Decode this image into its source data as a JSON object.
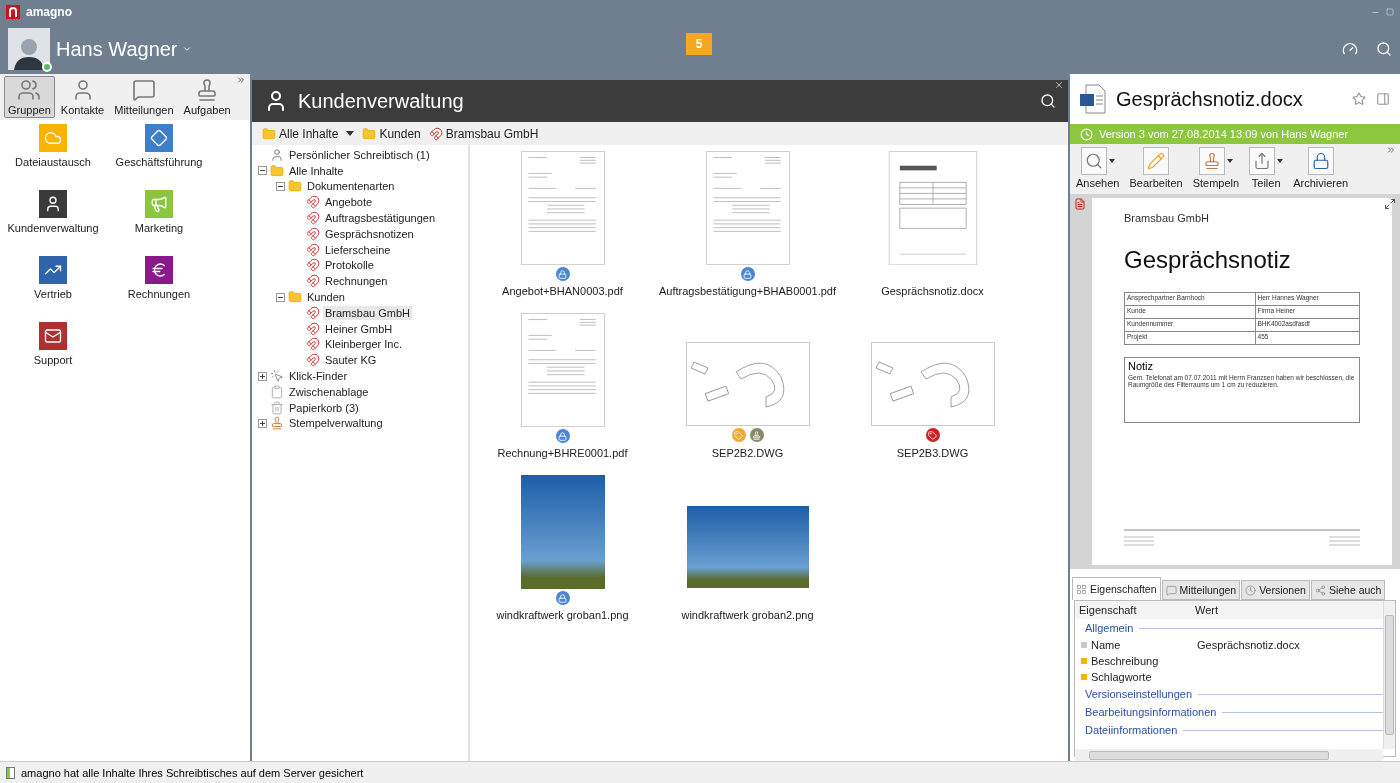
{
  "app": {
    "title": "amagno",
    "user": "Hans Wagner",
    "online": true,
    "notifications": "5"
  },
  "left_tabs": [
    {
      "label": "Gruppen",
      "kind": "group",
      "selected": true
    },
    {
      "label": "Kontakte",
      "kind": "person",
      "selected": false
    },
    {
      "label": "Mitteilungen",
      "kind": "message",
      "selected": false
    },
    {
      "label": "Aufgaben",
      "kind": "stamp",
      "selected": false
    }
  ],
  "groups": [
    {
      "label": "Dateiaustausch",
      "kind": "cloud",
      "color": "#f7b500"
    },
    {
      "label": "Geschäftsführung",
      "kind": "diamond",
      "color": "#3f7fc9"
    },
    {
      "label": "Kundenverwaltung",
      "kind": "person",
      "color": "#3a3a3a"
    },
    {
      "label": "Marketing",
      "kind": "megaphone",
      "color": "#8cc63f"
    },
    {
      "label": "Vertrieb",
      "kind": "trend",
      "color": "#2f64ad"
    },
    {
      "label": "Rechnungen",
      "kind": "euro",
      "color": "#8a1a8a"
    },
    {
      "label": "Support",
      "kind": "mail",
      "color": "#b03030"
    }
  ],
  "workspace": {
    "title": "Kundenverwaltung",
    "breadcrumb": [
      {
        "label": "Alle Inhalte",
        "kind": "folder",
        "dropdown": true
      },
      {
        "label": "Kunden",
        "kind": "folder",
        "dropdown": false
      },
      {
        "label": "Bramsbau GmbH",
        "kind": "magnet",
        "dropdown": false
      }
    ],
    "tree": [
      {
        "label": "Persönlicher Schreibtisch (1)",
        "kind": "person",
        "selected": false
      },
      {
        "label": "Alle Inhalte",
        "kind": "folder",
        "selected": false,
        "expanded": true,
        "children": [
          {
            "label": "Dokumentenarten",
            "kind": "folder",
            "selected": false,
            "expanded": true,
            "children": [
              {
                "label": "Angebote",
                "kind": "magnet",
                "selected": false
              },
              {
                "label": "Auftragsbestätigungen",
                "kind": "magnet",
                "selected": false
              },
              {
                "label": "Gesprächsnotizen",
                "kind": "magnet",
                "selected": false
              },
              {
                "label": "Lieferscheine",
                "kind": "magnet",
                "selected": false
              },
              {
                "label": "Protokolle",
                "kind": "magnet",
                "selected": false
              },
              {
                "label": "Rechnungen",
                "kind": "magnet",
                "selected": false
              }
            ]
          },
          {
            "label": "Kunden",
            "kind": "folder",
            "selected": false,
            "expanded": true,
            "children": [
              {
                "label": "Bramsbau GmbH",
                "kind": "magnet",
                "selected": true
              },
              {
                "label": "Heiner GmbH",
                "kind": "magnet",
                "selected": false
              },
              {
                "label": "Kleinberger Inc.",
                "kind": "magnet",
                "selected": false
              },
              {
                "label": "Sauter KG",
                "kind": "magnet",
                "selected": false
              }
            ]
          }
        ]
      },
      {
        "label": "Klick-Finder",
        "kind": "finder",
        "selected": false,
        "expanded": false
      },
      {
        "label": "Zwischenablage",
        "kind": "clipboard",
        "selected": false
      },
      {
        "label": "Papierkorb (3)",
        "kind": "trash",
        "selected": false
      },
      {
        "label": "Stempelverwaltung",
        "kind": "stamp",
        "selected": false,
        "expanded": false
      }
    ],
    "files": [
      {
        "name": "Angebot+BHAN0003.pdf",
        "kind": "invoice",
        "badges": [
          {
            "kind": "lock",
            "color": "#4a86d4"
          }
        ]
      },
      {
        "name": "Auftragsbestätigung+BHAB0001.pdf",
        "kind": "invoice",
        "badges": [
          {
            "kind": "lock",
            "color": "#4a86d4"
          }
        ]
      },
      {
        "name": "Gesprächsnotiz.docx",
        "kind": "note"
      },
      {
        "name": "Rechnung+BHRE0001.pdf",
        "kind": "invoice",
        "badges": [
          {
            "kind": "lock",
            "color": "#4a86d4"
          }
        ]
      },
      {
        "name": "SEP2B2.DWG",
        "kind": "drawing",
        "badges": [
          {
            "kind": "tag",
            "color": "#f0a830"
          },
          {
            "kind": "stamp",
            "color": "#8a8a6a"
          }
        ]
      },
      {
        "name": "SEP2B3.DWG",
        "kind": "drawing",
        "badges": [
          {
            "kind": "tag",
            "color": "#cc2222"
          }
        ]
      },
      {
        "name": "windkraftwerk groban1.png",
        "kind": "portrait",
        "badges": [
          {
            "kind": "lock",
            "color": "#4a86d4"
          }
        ]
      },
      {
        "name": "windkraftwerk groban2.png",
        "kind": "landscape"
      }
    ]
  },
  "document": {
    "title": "Gesprächsnotiz.docx",
    "version": "Version 3 vom 27.08.2014 13:09 von Hans Wagner",
    "actions": [
      {
        "label": "Ansehen",
        "kind": "view",
        "dropdown": true
      },
      {
        "label": "Bearbeiten",
        "kind": "edit",
        "dropdown": false
      },
      {
        "label": "Stempeln",
        "kind": "stamp",
        "dropdown": true
      },
      {
        "label": "Teilen",
        "kind": "share",
        "dropdown": true
      },
      {
        "label": "Archivieren",
        "kind": "lock",
        "dropdown": false
      }
    ],
    "preview": {
      "company": "Bramsbau GmbH",
      "heading": "Gesprächsnotiz",
      "table": [
        [
          "Ansprechpartner Barnhoch",
          "Herr Hannes Wagner"
        ],
        [
          "Kunde",
          "Firma Heiner"
        ],
        [
          "Kundennummer",
          "BHK4002asdfasdf"
        ],
        [
          "Projekt",
          "455"
        ]
      ],
      "note_title": "Notiz",
      "note_text": "Gem.  Telefonat am 07.07.2011 mit Herrn Franzsen haben wir beschlossen, die Raumgröße des Filterraums um 1 cm zu reduzieren."
    },
    "tabs": [
      {
        "label": "Eigenschaften",
        "kind": "grid",
        "selected": true
      },
      {
        "label": "Mitteilungen",
        "kind": "message",
        "selected": false
      },
      {
        "label": "Versionen",
        "kind": "clock",
        "selected": false
      },
      {
        "label": "Siehe auch",
        "kind": "link",
        "selected": false
      }
    ],
    "properties": {
      "columns": [
        "Eigenschaft",
        "Wert"
      ],
      "sections": [
        {
          "title": "Allgemein",
          "rows": [
            {
              "name": "Name",
              "value": "Gesprächsnotiz.docx",
              "color": "#c8c8c8"
            },
            {
              "name": "Beschreibung",
              "color": "#f7b500"
            },
            {
              "name": "Schlagworte",
              "color": "#f7b500"
            }
          ]
        },
        {
          "title": "Versionseinstellungen"
        },
        {
          "title": "Bearbeitungsinformationen"
        },
        {
          "title": "Dateiinformationen"
        }
      ]
    }
  },
  "status_bar": "amagno hat alle Inhalte Ihres Schreibtisches auf dem Server gesichert"
}
